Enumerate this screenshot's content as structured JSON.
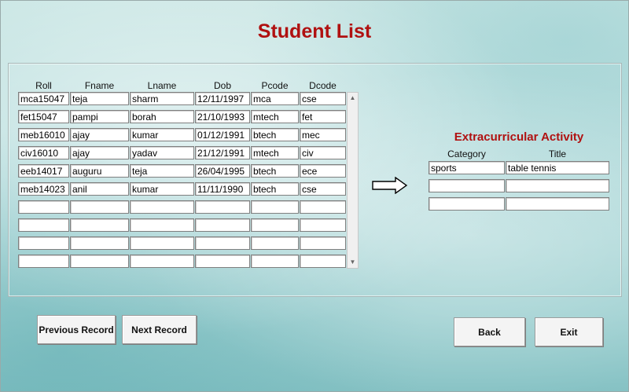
{
  "page_title": "Student List",
  "student_table": {
    "columns": [
      "Roll",
      "Fname",
      "Lname",
      "Dob",
      "Pcode",
      "Dcode"
    ],
    "rows": [
      [
        "mca15047",
        "teja",
        "sharm",
        "12/11/1997",
        "mca",
        "cse"
      ],
      [
        "fet15047",
        "pampi",
        "borah",
        "21/10/1993",
        "mtech",
        "fet"
      ],
      [
        "meb16010",
        "ajay",
        "kumar",
        "01/12/1991",
        "btech",
        "mec"
      ],
      [
        "civ16010",
        "ajay",
        "yadav",
        "21/12/1991",
        "mtech",
        "civ"
      ],
      [
        "eeb14017",
        "auguru",
        "teja",
        "26/04/1995",
        "btech",
        "ece"
      ],
      [
        "meb14023",
        "anil",
        "kumar",
        "11/11/1990",
        "btech",
        "cse"
      ],
      [
        "",
        "",
        "",
        "",
        "",
        ""
      ],
      [
        "",
        "",
        "",
        "",
        "",
        ""
      ],
      [
        "",
        "",
        "",
        "",
        "",
        ""
      ],
      [
        "",
        "",
        "",
        "",
        "",
        ""
      ]
    ]
  },
  "extracurricular": {
    "title": "Extracurricular Activity",
    "columns": [
      "Category",
      "Title"
    ],
    "rows": [
      [
        "sports",
        "table tennis"
      ],
      [
        "",
        ""
      ],
      [
        "",
        ""
      ]
    ]
  },
  "buttons": {
    "previous": "Previous Record",
    "next": "Next Record",
    "back": "Back",
    "exit": "Exit"
  },
  "icons": {
    "arrow": "arrow-right-icon",
    "scroll_up": "scroll-up-icon",
    "scroll_down": "scroll-down-icon"
  }
}
